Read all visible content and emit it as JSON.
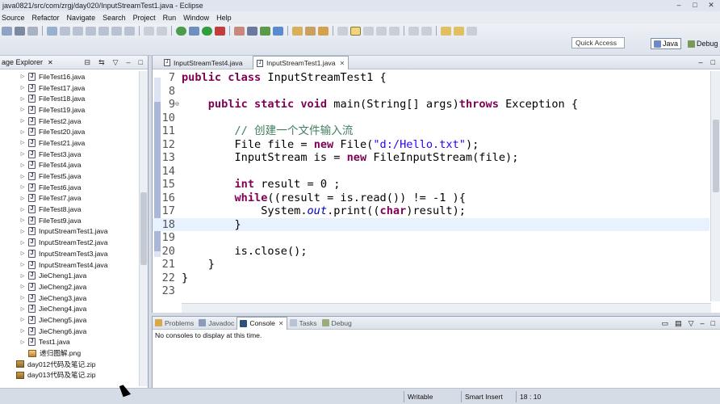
{
  "window": {
    "title": "java0821/src/com/zrgj/day020/InputStreamTest1.java - Eclipse"
  },
  "menu": [
    "Source",
    "Refactor",
    "Navigate",
    "Search",
    "Project",
    "Run",
    "Window",
    "Help"
  ],
  "toolbar": {
    "quick_access": "Quick Access",
    "perspective_java": "Java",
    "perspective_debug": "Debug"
  },
  "package_explorer": {
    "title": "age Explorer",
    "items": [
      {
        "label": "FileTest16.java",
        "kind": "java"
      },
      {
        "label": "FileTest17.java",
        "kind": "java"
      },
      {
        "label": "FileTest18.java",
        "kind": "java"
      },
      {
        "label": "FileTest19.java",
        "kind": "java"
      },
      {
        "label": "FileTest2.java",
        "kind": "java"
      },
      {
        "label": "FileTest20.java",
        "kind": "java"
      },
      {
        "label": "FileTest21.java",
        "kind": "java"
      },
      {
        "label": "FileTest3.java",
        "kind": "java"
      },
      {
        "label": "FileTest4.java",
        "kind": "java"
      },
      {
        "label": "FileTest5.java",
        "kind": "java"
      },
      {
        "label": "FileTest6.java",
        "kind": "java"
      },
      {
        "label": "FileTest7.java",
        "kind": "java"
      },
      {
        "label": "FileTest8.java",
        "kind": "java"
      },
      {
        "label": "FileTest9.java",
        "kind": "java"
      },
      {
        "label": "InputStreamTest1.java",
        "kind": "java"
      },
      {
        "label": "InputStreamTest2.java",
        "kind": "java"
      },
      {
        "label": "InputStreamTest3.java",
        "kind": "java"
      },
      {
        "label": "InputStreamTest4.java",
        "kind": "java"
      },
      {
        "label": "JieCheng1.java",
        "kind": "java"
      },
      {
        "label": "JieCheng2.java",
        "kind": "java"
      },
      {
        "label": "JieCheng3.java",
        "kind": "java"
      },
      {
        "label": "JieCheng4.java",
        "kind": "java"
      },
      {
        "label": "JieCheng5.java",
        "kind": "java"
      },
      {
        "label": "JieCheng6.java",
        "kind": "java"
      },
      {
        "label": "Test1.java",
        "kind": "java"
      },
      {
        "label": "递归图解.png",
        "kind": "image"
      },
      {
        "label": "day012代码及笔记.zip",
        "kind": "zip"
      },
      {
        "label": "day013代码及笔记.zip",
        "kind": "zip"
      }
    ]
  },
  "editor": {
    "tabs": [
      {
        "label": "InputStreamTest4.java",
        "active": false
      },
      {
        "label": "InputStreamTest1.java",
        "active": true
      }
    ],
    "lines": [
      {
        "n": "7",
        "text": "public class InputStreamTest1 {"
      },
      {
        "n": "8",
        "text": ""
      },
      {
        "n": "9",
        "text": "    public static void main(String[] args)throws Exception {"
      },
      {
        "n": "10",
        "text": ""
      },
      {
        "n": "11",
        "text": "        // 创建一个文件输入流"
      },
      {
        "n": "12",
        "text": "        File file = new File(\"d:/Hello.txt\");"
      },
      {
        "n": "13",
        "text": "        InputStream is = new FileInputStream(file);"
      },
      {
        "n": "14",
        "text": ""
      },
      {
        "n": "15",
        "text": "        int result = 0 ;"
      },
      {
        "n": "16",
        "text": "        while((result = is.read()) != -1 ){"
      },
      {
        "n": "17",
        "text": "            System.out.print((char)result);"
      },
      {
        "n": "18",
        "text": "        }"
      },
      {
        "n": "19",
        "text": ""
      },
      {
        "n": "20",
        "text": "        is.close();"
      },
      {
        "n": "21",
        "text": "    }"
      },
      {
        "n": "22",
        "text": "}"
      },
      {
        "n": "23",
        "text": ""
      }
    ],
    "current_line": "18"
  },
  "console": {
    "tabs": [
      "Problems",
      "Javadoc",
      "Console",
      "Tasks",
      "Debug"
    ],
    "active_tab": "Console",
    "message": "No consoles to display at this time."
  },
  "status": {
    "mode": "Writable",
    "insert": "Smart Insert",
    "position": "18 : 10"
  },
  "colors": {
    "keyword": "#7f0055",
    "string": "#2a00ff",
    "comment": "#3f7f5f",
    "field": "#0000c0",
    "current_line": "#e8f2fe"
  }
}
